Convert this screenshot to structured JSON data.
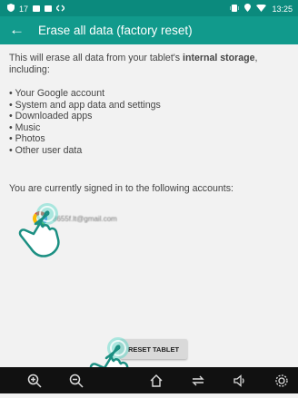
{
  "statusbar": {
    "notif": "17",
    "time": "13:25"
  },
  "appbar": {
    "back": "←",
    "title": "Erase all data (factory reset)"
  },
  "content": {
    "intro_prefix": "This will erase all data from your tablet's ",
    "intro_bold": "internal storage",
    "intro_suffix": ", including:",
    "items": [
      "Your Google account",
      "System and app data and settings",
      "Downloaded apps",
      "Music",
      "Photos",
      "Other user data"
    ],
    "signed_in": "You are currently signed in to the following accounts:"
  },
  "account": {
    "email": "8655f.lt@gmail.com"
  },
  "reset_button": {
    "label": "RESET TABLET"
  },
  "colors": {
    "statusbar": "#0b8a7d",
    "appbar": "#119a8c",
    "navbar": "#111111",
    "hand": "#ffffff"
  },
  "icons": [
    "zoom-in-icon",
    "zoom-out-icon",
    "home-icon",
    "recents-icon",
    "volume-icon",
    "screenshot-icon",
    "back-arrow-icon",
    "hand-pointer-icon"
  ]
}
